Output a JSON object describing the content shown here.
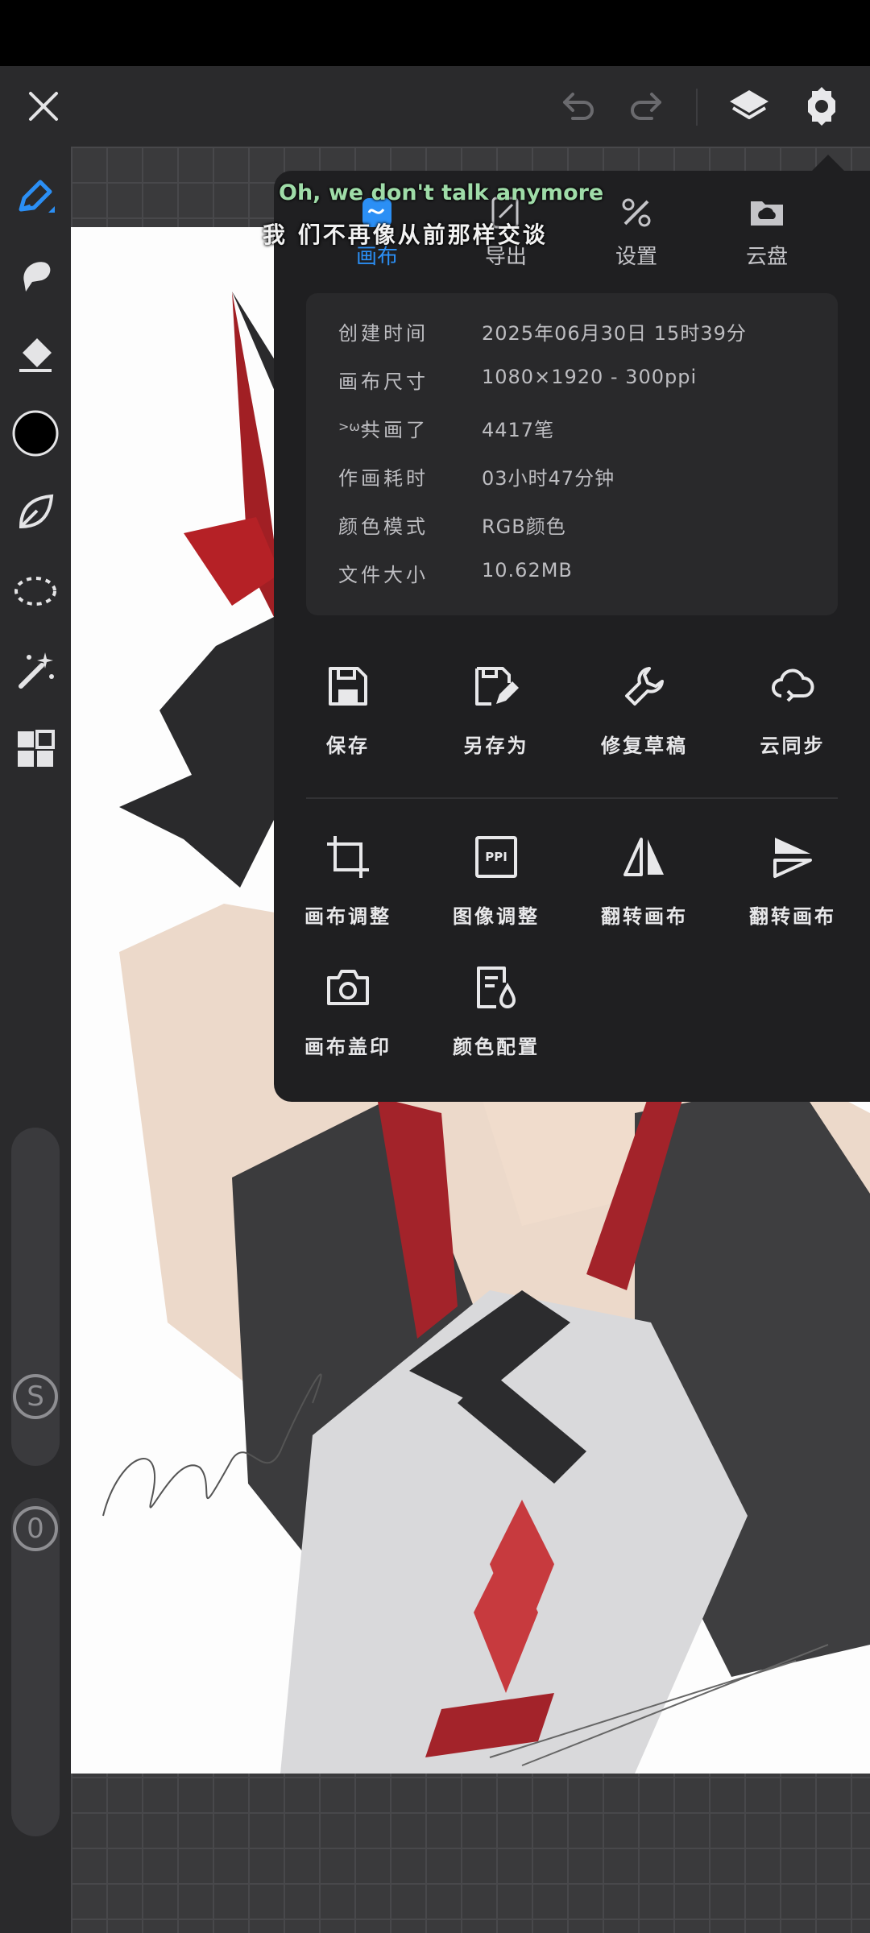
{
  "top_bar": {
    "close_icon": "close-icon",
    "undo_icon": "undo-icon",
    "redo_icon": "redo-icon",
    "layers_icon": "layers-icon",
    "settings_icon": "gear-icon"
  },
  "left_toolbar": {
    "tools": [
      "brush-icon",
      "smudge-icon",
      "eraser-icon",
      "color-swatch",
      "leaf-shape-icon",
      "lasso-icon",
      "magic-wand-icon",
      "grid-apps-icon"
    ],
    "size_slider_label": "S",
    "opacity_slider_label": "0",
    "current_color": "#000000"
  },
  "panel": {
    "tabs": [
      {
        "label": "画布",
        "icon": "canvas-icon",
        "active": true
      },
      {
        "label": "导出",
        "icon": "export-icon",
        "active": false
      },
      {
        "label": "设置",
        "icon": "tools-settings-icon",
        "active": false
      },
      {
        "label": "云盘",
        "icon": "cloud-folder-icon",
        "active": false
      }
    ],
    "info": [
      {
        "key": "创建时间",
        "value": "2025年06月30日  15时39分"
      },
      {
        "key": "画布尺寸",
        "value": "1080×1920 - 300ppi"
      },
      {
        "key": "共画了",
        "value": "4417笔"
      },
      {
        "key": "作画耗时",
        "value": "03小时47分钟"
      },
      {
        "key": "颜色模式",
        "value": "RGB颜色"
      },
      {
        "key": "文件大小",
        "value": "10.62MB"
      }
    ],
    "info_prefix": ">ω<",
    "actions_row1": [
      {
        "label": "保存",
        "icon": "save-icon"
      },
      {
        "label": "另存为",
        "icon": "save-as-icon"
      },
      {
        "label": "修复草稿",
        "icon": "wrench-icon"
      },
      {
        "label": "云同步",
        "icon": "cloud-sync-icon"
      }
    ],
    "actions_row2": [
      {
        "label": "画布调整",
        "icon": "crop-icon"
      },
      {
        "label": "图像调整",
        "icon": "ppi-icon",
        "badge": "PPI"
      },
      {
        "label": "翻转画布",
        "icon": "flip-horizontal-icon"
      },
      {
        "label": "翻转画布",
        "icon": "flip-vertical-icon"
      }
    ],
    "actions_row3": [
      {
        "label": "画布盖印",
        "icon": "camera-icon"
      },
      {
        "label": "颜色配置",
        "icon": "color-config-icon"
      }
    ]
  },
  "lyrics": {
    "line1": "Oh, we don't talk anymore",
    "line2": "我 们不再像从前那样交谈"
  },
  "artwork": {
    "signature": "mian"
  },
  "colors": {
    "accent": "#2b8ff5",
    "panel_bg": "#1f1f21",
    "info_bg": "#29292b"
  }
}
